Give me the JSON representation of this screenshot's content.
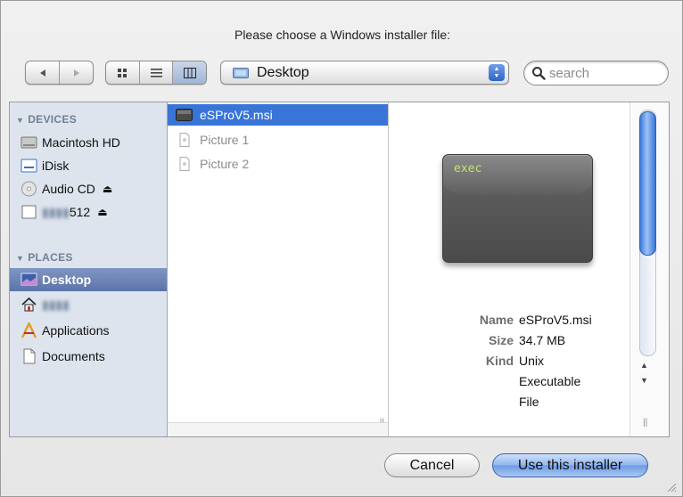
{
  "dialog": {
    "prompt": "Please choose a Windows installer file:"
  },
  "toolbar": {
    "location": "Desktop",
    "search_placeholder": "search"
  },
  "sidebar": {
    "devices_header": "DEVICES",
    "places_header": "PLACES",
    "devices": [
      {
        "label": "Macintosh HD",
        "icon": "hard-drive-icon"
      },
      {
        "label": "iDisk",
        "icon": "idisk-icon"
      },
      {
        "label": "Audio CD",
        "icon": "cd-icon",
        "eject": "⏏"
      },
      {
        "label_obscured": "▮▮▮▮",
        "label_suffix": "512",
        "icon": "drive-icon",
        "eject": "⏏"
      }
    ],
    "places": [
      {
        "label": "Desktop",
        "icon": "desktop-icon",
        "selected": true
      },
      {
        "label_obscured": "▮▮▮▮",
        "icon": "home-icon"
      },
      {
        "label": "Applications",
        "icon": "applications-icon"
      },
      {
        "label": "Documents",
        "icon": "documents-icon"
      }
    ]
  },
  "files": [
    {
      "name": "eSProV5.msi",
      "selected": true,
      "icon": "executable-icon"
    },
    {
      "name": "Picture 1",
      "selected": false,
      "icon": "image-file-icon"
    },
    {
      "name": "Picture 2",
      "selected": false,
      "icon": "image-file-icon"
    }
  ],
  "preview": {
    "icon_text": "exec",
    "name_label": "Name",
    "name_value": "eSProV5.msi",
    "size_label": "Size",
    "size_value": "34.7 MB",
    "kind_label": "Kind",
    "kind_value_lines": [
      "Unix",
      "Executable",
      "File"
    ]
  },
  "buttons": {
    "cancel": "Cancel",
    "ok": "Use this installer"
  },
  "colors": {
    "selection": "#3875d7",
    "sidebar_bg": "#dde4ed",
    "sidebar_selected": "#6a81b6"
  }
}
